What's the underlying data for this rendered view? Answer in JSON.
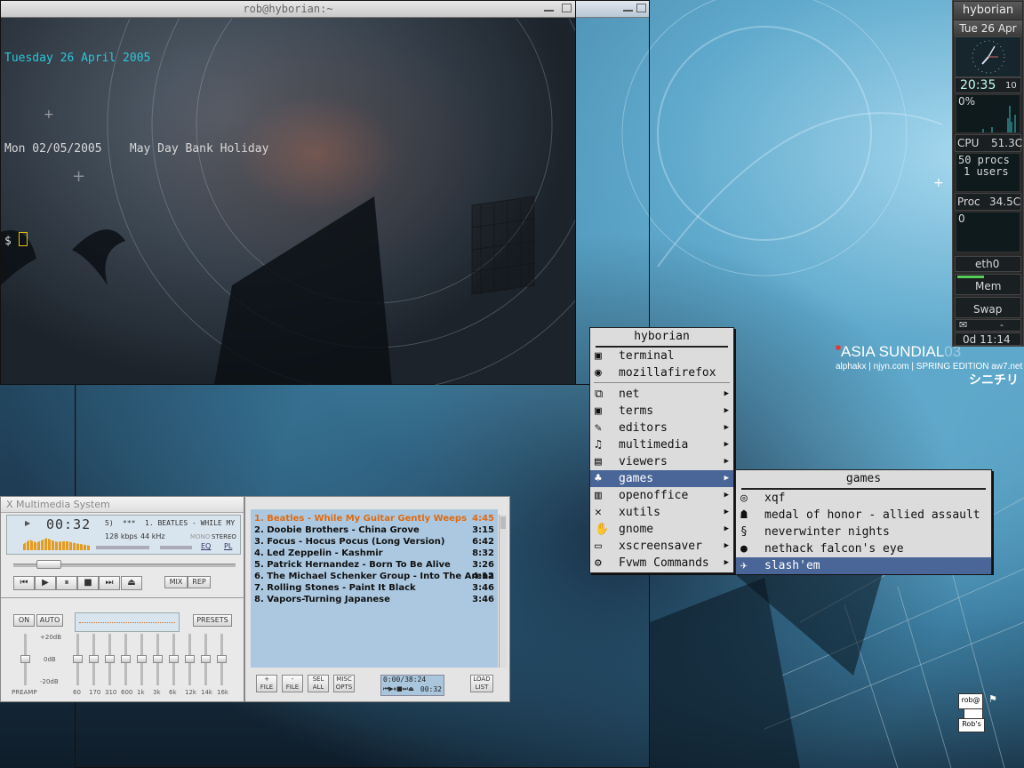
{
  "terminal": {
    "title": "rob@hyborian:~",
    "lines": [
      "Tuesday 26 April 2005",
      "",
      "Mon 02/05/2005    May Day Bank Holiday",
      "",
      "$ "
    ]
  },
  "wallpaper": {
    "title": "ASIA SUNDIAL",
    "suffix": "03",
    "credit": "alphakx | njyn.com | SPRING EDITION aw7.net",
    "kana": "シニチリ"
  },
  "gkrellm": {
    "hostname": "hyborian",
    "date": "Tue 26 Apr",
    "time": "20:35",
    "seconds": "10",
    "cpu_percent": "0%",
    "cpu_label": "CPU",
    "cpu_temp": "51.3C",
    "procs": "50 procs",
    "users": "1 users",
    "proc_label": "Proc",
    "proc_temp": "34.5C",
    "proc_value": "0",
    "net_label": "eth0",
    "mem_label": "Mem",
    "swap_label": "Swap",
    "mail": "-",
    "uptime": "0d 11:14"
  },
  "menu": {
    "title": "hyborian",
    "items": [
      {
        "label": "terminal",
        "icon": "terminal-icon",
        "sub": false
      },
      {
        "label": "mozillafirefox",
        "icon": "firefox-icon",
        "sub": false
      },
      {
        "label": "net",
        "icon": "network-icon",
        "sub": true
      },
      {
        "label": "terms",
        "icon": "terminal-icon",
        "sub": true
      },
      {
        "label": "editors",
        "icon": "editor-icon",
        "sub": true
      },
      {
        "label": "multimedia",
        "icon": "multimedia-icon",
        "sub": true
      },
      {
        "label": "viewers",
        "icon": "viewer-icon",
        "sub": true
      },
      {
        "label": "games",
        "icon": "games-icon",
        "sub": true,
        "selected": true
      },
      {
        "label": "openoffice",
        "icon": "office-icon",
        "sub": true
      },
      {
        "label": "xutils",
        "icon": "xutils-icon",
        "sub": true
      },
      {
        "label": "gnome",
        "icon": "gnome-icon",
        "sub": true
      },
      {
        "label": "xscreensaver",
        "icon": "screensaver-icon",
        "sub": true
      },
      {
        "label": "Fvwm Commands",
        "icon": "gears-icon",
        "sub": true
      }
    ]
  },
  "games_menu": {
    "title": "games",
    "items": [
      {
        "label": "xqf",
        "icon": "xqf-icon"
      },
      {
        "label": "medal of honor - allied assault",
        "icon": "soldier-icon"
      },
      {
        "label": "neverwinter nights",
        "icon": "dragon-icon"
      },
      {
        "label": "nethack falcon's eye",
        "icon": "nethack-icon"
      },
      {
        "label": "slash'em",
        "icon": "slashem-icon",
        "selected": true
      }
    ]
  },
  "xmms": {
    "title": "X Multimedia System",
    "time": "00:32",
    "track_num": "5)",
    "stars": "***",
    "song_scroll": "1. BEATLES - WHILE MY",
    "kbps": "128",
    "kbps_unit": "kbps",
    "khz": "44",
    "khz_unit": "kHz",
    "mono": "MONO",
    "stereo": "STEREO",
    "eq": "EQ",
    "pl": "PL",
    "mix": "MIX",
    "rep": "REP",
    "on": "ON",
    "auto": "AUTO",
    "presets": "PRESETS",
    "db_plus": "+20dB",
    "db_zero": "0dB",
    "db_minus": "-20dB",
    "preamp": "PREAMP",
    "bands": [
      "60",
      "170",
      "310",
      "600",
      "1k",
      "3k",
      "6k",
      "12k",
      "14k",
      "16k"
    ]
  },
  "playlist": {
    "tracks": [
      {
        "title": "1. Beatles - While My Guitar Gently Weeps",
        "time": "4:45"
      },
      {
        "title": "2. Doobie Brothers - China Grove",
        "time": "3:15"
      },
      {
        "title": "3. Focus - Hocus Pocus (Long Version)",
        "time": "6:42"
      },
      {
        "title": "4. Led Zeppelin - Kashmir",
        "time": "8:32"
      },
      {
        "title": "5. Patrick Hernandez - Born To Be Alive",
        "time": "3:26"
      },
      {
        "title": "6. The Michael Schenker Group - Into The Arena",
        "time": "4:12"
      },
      {
        "title": "7. Rolling Stones - Paint It Black",
        "time": "3:46"
      },
      {
        "title": "8. Vapors-Turning Japanese",
        "time": "3:46"
      }
    ],
    "buttons": [
      {
        "top": "+",
        "bottom": "FILE"
      },
      {
        "top": "-",
        "bottom": "FILE"
      },
      {
        "top": "SEL",
        "bottom": "ALL"
      },
      {
        "top": "MISC",
        "bottom": "OPTS"
      }
    ],
    "total": "0:00/38:24",
    "elapsed": "00:32",
    "load_top": "LOAD",
    "load_bottom": "LIST"
  },
  "desktop_icon": {
    "label1": "rob@",
    "label2": "Rob's"
  },
  "colors": {
    "menu_selected": "#4a6598",
    "playlist_current": "#e06a10",
    "terminal_date": "#2ec4d6"
  }
}
